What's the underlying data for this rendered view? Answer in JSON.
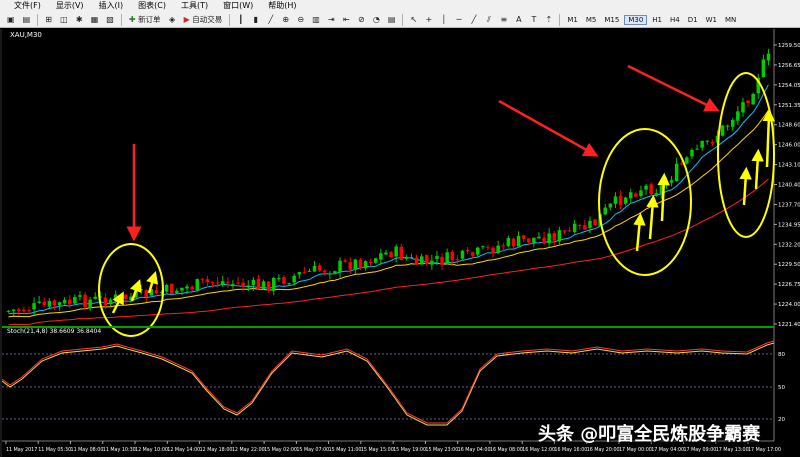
{
  "menu": [
    "文件(F)",
    "显示(V)",
    "插入(I)",
    "图表(C)",
    "工具(T)",
    "窗口(W)",
    "帮助(H)"
  ],
  "toolbar": {
    "new_order_label": "新订单",
    "autotrade_label": "自动交易",
    "timeframes": [
      "M1",
      "M5",
      "M15",
      "M30",
      "H1",
      "H4",
      "D1",
      "W1",
      "MN"
    ],
    "active_timeframe": "M30"
  },
  "chart": {
    "symbol_label": "XAU,M30",
    "price_ticks": [
      "1259.50",
      "1256.65",
      "1254.05",
      "1251.35",
      "1248.60",
      "1246.00",
      "1243.10",
      "1240.40",
      "1237.70",
      "1234.95",
      "1232.20",
      "1229.50",
      "1226.75",
      "1224.00",
      "1221.40"
    ],
    "stoch_label": "Stoch(21,4,8) 38.6609 36.8404",
    "stoch_levels": [
      "80",
      "50",
      "20"
    ],
    "time_ticks": [
      "11 May 2017",
      "11 May 05:30",
      "11 May 08:00",
      "11 May 10:30",
      "12 May 10:00",
      "12 May 14:00",
      "12 May 18:00",
      "12 May 22:00",
      "15 May 02:00",
      "15 May 07:00",
      "15 May 11:00",
      "15 May 15:00",
      "15 May 19:00",
      "15 May 23:00",
      "16 May 04:00",
      "16 May 08:00",
      "16 May 12:00",
      "16 May 16:00",
      "16 May 20:00",
      "17 May 00:00",
      "17 May 04:00",
      "17 May 09:00",
      "17 May 13:00",
      "17 May 17:00"
    ]
  },
  "watermark": "头条 @叩富全民炼股争霸赛",
  "colors": {
    "bull": "#00cc00",
    "bear": "#ff0000",
    "ma_fast": "#00bfff",
    "ma_mid": "#ffd700",
    "ma_slow": "#ff2020",
    "circle": "#ffff00",
    "arrow_red": "#ff2020",
    "arrow_yellow": "#ffff00",
    "stoch_main": "#ff3b3b",
    "stoch_signal": "#ffd24d",
    "separator": "#00a000"
  }
}
